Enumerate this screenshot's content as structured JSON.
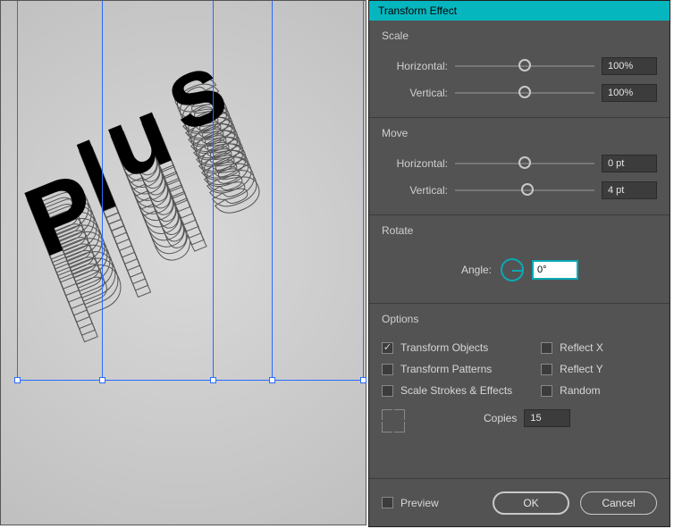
{
  "canvas": {
    "artwork_text": "Plus"
  },
  "panel": {
    "title": "Transform Effect",
    "scale": {
      "title": "Scale",
      "horizontal_label": "Horizontal:",
      "horizontal_value": "100%",
      "horizontal_pos": 0.5,
      "vertical_label": "Vertical:",
      "vertical_value": "100%",
      "vertical_pos": 0.5
    },
    "move": {
      "title": "Move",
      "horizontal_label": "Horizontal:",
      "horizontal_value": "0 pt",
      "horizontal_pos": 0.5,
      "vertical_label": "Vertical:",
      "vertical_value": "4 pt",
      "vertical_pos": 0.52
    },
    "rotate": {
      "title": "Rotate",
      "angle_label": "Angle:",
      "angle_value": "0°"
    },
    "options": {
      "title": "Options",
      "transform_objects": {
        "label": "Transform Objects",
        "checked": true
      },
      "transform_patterns": {
        "label": "Transform Patterns",
        "checked": false
      },
      "scale_strokes": {
        "label": "Scale Strokes & Effects",
        "checked": false
      },
      "reflect_x": {
        "label": "Reflect X",
        "checked": false
      },
      "reflect_y": {
        "label": "Reflect Y",
        "checked": false
      },
      "random": {
        "label": "Random",
        "checked": false
      },
      "copies_label": "Copies",
      "copies_value": "15"
    },
    "footer": {
      "preview_label": "Preview",
      "preview_checked": false,
      "ok_label": "OK",
      "cancel_label": "Cancel"
    }
  }
}
